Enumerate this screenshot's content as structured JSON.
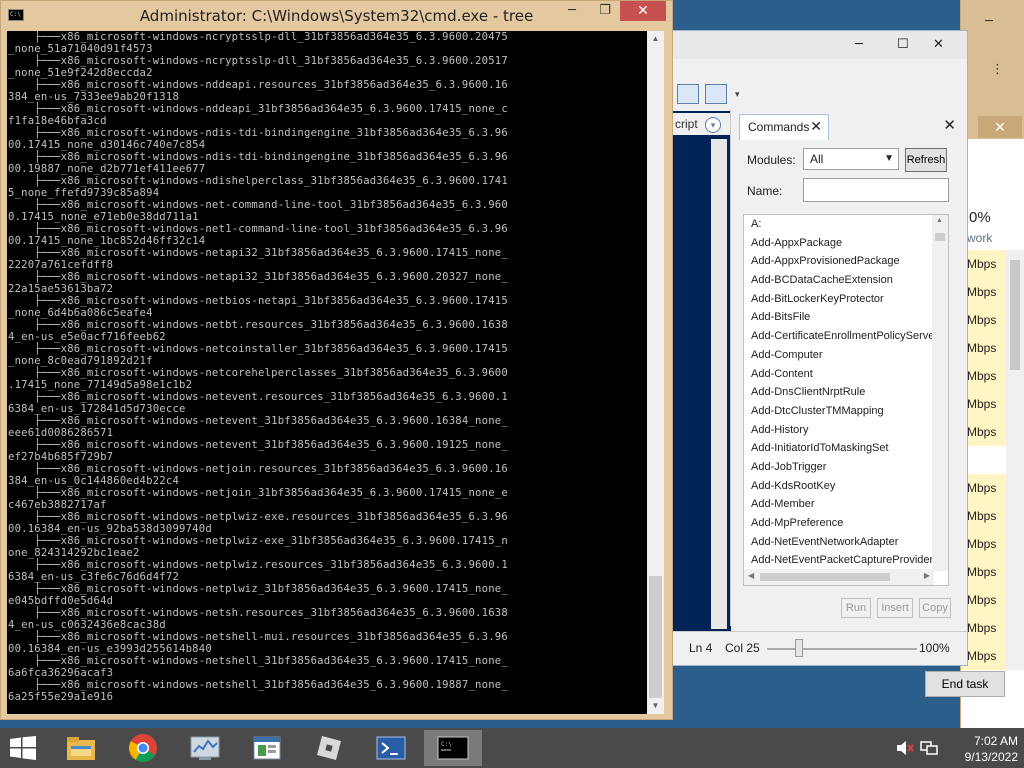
{
  "cmd": {
    "title": "Administrator: C:\\Windows\\System32\\cmd.exe - tree",
    "icon_text": "C:\\",
    "icons": {
      "minimize": "minimize-icon",
      "maximize": "maximize-icon",
      "close": "close-icon"
    },
    "output_lines": [
      "    ├───x86_microsoft-windows-ncryptsslp-dll_31bf3856ad364e35_6.3.9600.20475",
      "_none_51a71040d91f4573",
      "    ├───x86_microsoft-windows-ncryptsslp-dll_31bf3856ad364e35_6.3.9600.20517",
      "_none_51e9f242d8eccda2",
      "    ├───x86_microsoft-windows-nddeapi.resources_31bf3856ad364e35_6.3.9600.16",
      "384_en-us_7333ee9ab20f1318",
      "    ├───x86_microsoft-windows-nddeapi_31bf3856ad364e35_6.3.9600.17415_none_c",
      "f1fa18e46bfa3cd",
      "    ├───x86_microsoft-windows-ndis-tdi-bindingengine_31bf3856ad364e35_6.3.96",
      "00.17415_none_d30146c740e7c854",
      "    ├───x86_microsoft-windows-ndis-tdi-bindingengine_31bf3856ad364e35_6.3.96",
      "00.19887_none_d2b771ef411ee677",
      "    ├───x86_microsoft-windows-ndishelperclass_31bf3856ad364e35_6.3.9600.1741",
      "5_none_ffefd9739c85a894",
      "    ├───x86_microsoft-windows-net-command-line-tool_31bf3856ad364e35_6.3.960",
      "0.17415_none_e71eb0e38dd711a1",
      "    ├───x86_microsoft-windows-net1-command-line-tool_31bf3856ad364e35_6.3.96",
      "00.17415_none_1bc852d46ff32c14",
      "    ├───x86_microsoft-windows-netapi32_31bf3856ad364e35_6.3.9600.17415_none_",
      "22207a761cefdff8",
      "    ├───x86_microsoft-windows-netapi32_31bf3856ad364e35_6.3.9600.20327_none_",
      "22a15ae53613ba72",
      "    ├───x86_microsoft-windows-netbios-netapi_31bf3856ad364e35_6.3.9600.17415",
      "_none_6d4b6a086c5eafe4",
      "    ├───x86_microsoft-windows-netbt.resources_31bf3856ad364e35_6.3.9600.1638",
      "4_en-us_e5e0acf716feeb62",
      "    ├───x86_microsoft-windows-netcoinstaller_31bf3856ad364e35_6.3.9600.17415",
      "_none_8c0ead791892d21f",
      "    ├───x86_microsoft-windows-netcorehelperclasses_31bf3856ad364e35_6.3.9600",
      ".17415_none_77149d5a98e1c1b2",
      "    ├───x86_microsoft-windows-netevent.resources_31bf3856ad364e35_6.3.9600.1",
      "6384_en-us_172841d5d730ecce",
      "    ├───x86_microsoft-windows-netevent_31bf3856ad364e35_6.3.9600.16384_none_",
      "eee61d0086286571",
      "    ├───x86_microsoft-windows-netevent_31bf3856ad364e35_6.3.9600.19125_none_",
      "ef27b4b685f729b7",
      "    ├───x86_microsoft-windows-netjoin.resources_31bf3856ad364e35_6.3.9600.16",
      "384_en-us_0c144860ed4b22c4",
      "    ├───x86_microsoft-windows-netjoin_31bf3856ad364e35_6.3.9600.17415_none_e",
      "c467eb3882717af",
      "    ├───x86_microsoft-windows-netplwiz-exe.resources_31bf3856ad364e35_6.3.96",
      "00.16384_en-us_92ba538d3099740d",
      "    ├───x86_microsoft-windows-netplwiz-exe_31bf3856ad364e35_6.3.9600.17415_n",
      "one_824314292bc1eae2",
      "    ├───x86_microsoft-windows-netplwiz.resources_31bf3856ad364e35_6.3.9600.1",
      "6384_en-us_c3fe6c76d6d4f72",
      "    ├───x86_microsoft-windows-netplwiz_31bf3856ad364e35_6.3.9600.17415_none_",
      "e045bdffd0e5d64d",
      "    ├───x86_microsoft-windows-netsh.resources_31bf3856ad364e35_6.3.9600.1638",
      "4_en-us_c0632436e8cac38d",
      "    ├───x86_microsoft-windows-netshell-mui.resources_31bf3856ad364e35_6.3.96",
      "00.16384_en-us_e3993d255614b840",
      "    ├───x86_microsoft-windows-netshell_31bf3856ad364e35_6.3.9600.17415_none_",
      "6a6fca36296acaf3",
      "    ├───x86_microsoft-windows-netshell_31bf3856ad364e35_6.3.9600.19887_none_",
      "6a25f55e29a1e916"
    ]
  },
  "ise": {
    "script_tab_label": "cript",
    "status": {
      "line": "Ln 4",
      "col": "Col 25",
      "zoom": "100%"
    },
    "commands_pane": {
      "tab_label": "Commands",
      "modules_label": "Modules:",
      "modules_value": "All",
      "refresh_label": "Refresh",
      "name_label": "Name:",
      "name_value": "",
      "items": [
        "A:",
        "Add-AppxPackage",
        "Add-AppxProvisionedPackage",
        "Add-BCDataCacheExtension",
        "Add-BitLockerKeyProtector",
        "Add-BitsFile",
        "Add-CertificateEnrollmentPolicyServer",
        "Add-Computer",
        "Add-Content",
        "Add-DnsClientNrptRule",
        "Add-DtcClusterTMMapping",
        "Add-History",
        "Add-InitiatorIdToMaskingSet",
        "Add-JobTrigger",
        "Add-KdsRootKey",
        "Add-Member",
        "Add-MpPreference",
        "Add-NetEventNetworkAdapter",
        "Add-NetEventPacketCaptureProvider"
      ],
      "run_label": "Run",
      "insert_label": "Insert",
      "copy_label": "Copy"
    }
  },
  "taskmgr": {
    "header_pct": "0%",
    "header_col": "work",
    "rows": [
      "Mbps",
      "Mbps",
      "Mbps",
      "Mbps",
      "Mbps",
      "Mbps",
      "Mbps",
      "",
      "Mbps",
      "Mbps",
      "Mbps",
      "Mbps",
      "Mbps",
      "Mbps",
      "Mbps"
    ],
    "end_task_label": "End task"
  },
  "taskbar": {
    "apps": [
      {
        "name": "file-explorer-icon",
        "active": false
      },
      {
        "name": "chrome-icon",
        "active": false
      },
      {
        "name": "resource-monitor-icon",
        "active": false
      },
      {
        "name": "event-viewer-icon",
        "active": false
      },
      {
        "name": "roblox-icon",
        "active": false
      },
      {
        "name": "powershell-icon",
        "active": false
      },
      {
        "name": "cmd-icon",
        "active": true
      }
    ],
    "clock_time": "7:02 AM",
    "clock_date": "9/13/2022"
  },
  "colors": {
    "cmd_frame": "#e4c9a0",
    "console_bg": "#000000",
    "console_fg": "#c0c0c0",
    "close_red": "#c75050",
    "ise_editor": "#012456",
    "taskmgr_highlight": "#fff4c4",
    "taskbar": "#4a4a4a"
  }
}
